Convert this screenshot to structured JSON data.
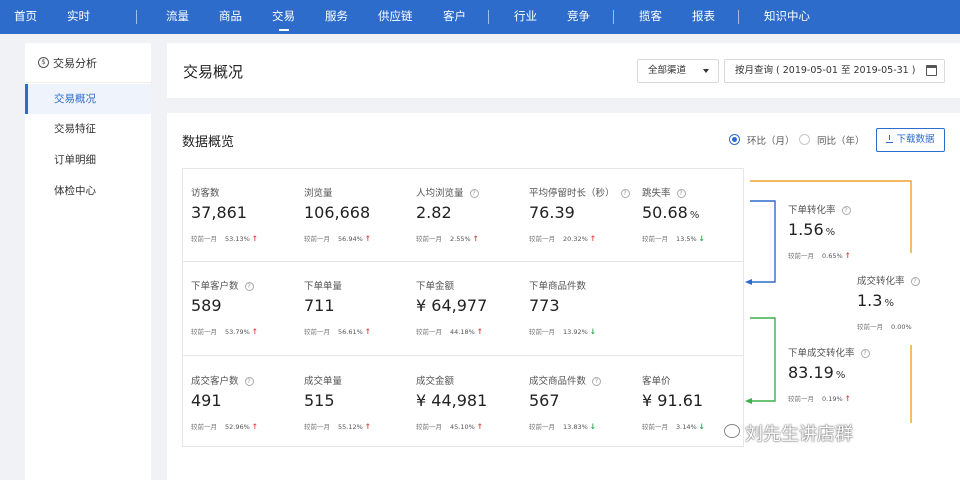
{
  "nav": {
    "items": [
      "首页",
      "实时",
      "流量",
      "商品",
      "交易",
      "服务",
      "供应链",
      "客户",
      "行业",
      "竞争",
      "揽客",
      "报表",
      "知识中心"
    ],
    "active_index": 4
  },
  "sidebar": {
    "section_title": "交易分析",
    "items": [
      "交易概况",
      "交易特征",
      "订单明细",
      "体检中心"
    ],
    "active_index": 0
  },
  "header": {
    "page_title": "交易概况",
    "channel_select": "全部渠道",
    "date_range": "按月查询 ( 2019-05-01 至 2019-05-31 )"
  },
  "overview": {
    "title": "数据概览",
    "radio_options": [
      "环比（月）",
      "同比（年）"
    ],
    "radio_selected": 0,
    "download_label": "下载数据",
    "compare_label": "较前一月",
    "metrics": [
      {
        "label": "访客数",
        "help": "",
        "value": "37,861",
        "unit": "",
        "pct": "53.13%",
        "trend": "up"
      },
      {
        "label": "浏览量",
        "help": "",
        "value": "106,668",
        "unit": "",
        "pct": "56.94%",
        "trend": "up"
      },
      {
        "label": "人均浏览量",
        "help": "?",
        "value": "2.82",
        "unit": "",
        "pct": "2.55%",
        "trend": "up"
      },
      {
        "label": "平均停留时长（秒）",
        "help": "?",
        "value": "76.39",
        "unit": "",
        "pct": "20.32%",
        "trend": "up"
      },
      {
        "label": "跳失率",
        "help": "?",
        "value": "50.68",
        "unit": "%",
        "pct": "13.5%",
        "trend": "down"
      },
      {
        "label": "下单客户数",
        "help": "?",
        "value": "589",
        "unit": "",
        "pct": "53.79%",
        "trend": "up"
      },
      {
        "label": "下单单量",
        "help": "",
        "value": "711",
        "unit": "",
        "pct": "56.61%",
        "trend": "up"
      },
      {
        "label": "下单金额",
        "help": "",
        "value": "¥ 64,977",
        "unit": "",
        "pct": "44.18%",
        "trend": "up"
      },
      {
        "label": "下单商品件数",
        "help": "",
        "value": "773",
        "unit": "",
        "pct": "13.92%",
        "trend": "down"
      },
      {
        "label": "成交客户数",
        "help": "?",
        "value": "491",
        "unit": "",
        "pct": "52.96%",
        "trend": "up"
      },
      {
        "label": "成交单量",
        "help": "",
        "value": "515",
        "unit": "",
        "pct": "55.12%",
        "trend": "up"
      },
      {
        "label": "成交金额",
        "help": "",
        "value": "¥ 44,981",
        "unit": "",
        "pct": "45.10%",
        "trend": "up"
      },
      {
        "label": "成交商品件数",
        "help": "?",
        "value": "567",
        "unit": "",
        "pct": "13.83%",
        "trend": "down"
      },
      {
        "label": "客单价",
        "help": "",
        "value": "¥ 91.61",
        "unit": "",
        "pct": "3.14%",
        "trend": "down"
      }
    ],
    "conversions": [
      {
        "label": "下单转化率",
        "help": "?",
        "value": "1.56",
        "unit": "%",
        "pct": "0.65%",
        "trend": "up"
      },
      {
        "label": "成交转化率",
        "help": "?",
        "value": "1.3",
        "unit": "%",
        "pct": "0.00%",
        "trend": "none"
      },
      {
        "label": "下单成交转化率",
        "help": "?",
        "value": "83.19",
        "unit": "%",
        "pct": "0.19%",
        "trend": "up"
      }
    ],
    "colors": {
      "line_blue": "#2d6ccb",
      "line_green": "#3db04a",
      "line_orange": "#f0a02a",
      "up": "#e64545",
      "down": "#2fa84f"
    }
  },
  "watermark": "刘先生讲店群"
}
